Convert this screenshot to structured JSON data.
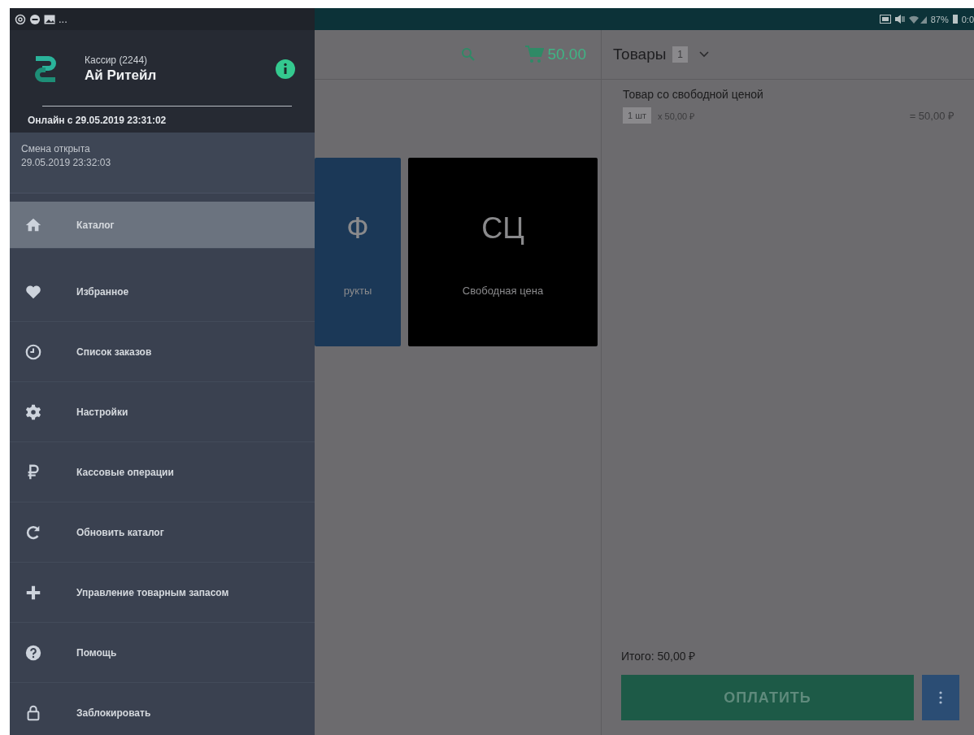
{
  "status_bar": {
    "left_text": "...",
    "battery": "87%",
    "time": "0:0"
  },
  "drawer": {
    "role": "Кассир (2244)",
    "store": "Ай Ритейл",
    "online": "Онлайн с 29.05.2019 23:31:02",
    "shift_status": "Смена открыта",
    "shift_time": "29.05.2019 23:32:03",
    "items": [
      {
        "label": "Каталог",
        "selected": true
      },
      {
        "label": "Избранное",
        "selected": false
      },
      {
        "label": "Список заказов",
        "selected": false
      },
      {
        "label": "Настройки",
        "selected": false
      },
      {
        "label": "Кассовые операции",
        "selected": false
      },
      {
        "label": "Обновить каталог",
        "selected": false
      },
      {
        "label": "Управление товарным запасом",
        "selected": false
      },
      {
        "label": "Помощь",
        "selected": false
      },
      {
        "label": "Заблокировать",
        "selected": false
      }
    ]
  },
  "toolbar": {
    "cart_total": "50.00"
  },
  "tiles": [
    {
      "abbr": "Ф",
      "label": "рукты",
      "color": "#1b3857"
    },
    {
      "abbr": "СЦ",
      "label": "Свободная цена",
      "color": "#000000"
    }
  ],
  "order": {
    "title": "Товары",
    "count": "1",
    "lines": [
      {
        "name": "Товар со свободной ценой",
        "qty": "1 шт",
        "price": "x 50,00 ₽",
        "sum": "= 50,00 ₽"
      }
    ],
    "total": "Итого: 50,00 ₽",
    "pay_button": "ОПЛАТИТЬ"
  }
}
